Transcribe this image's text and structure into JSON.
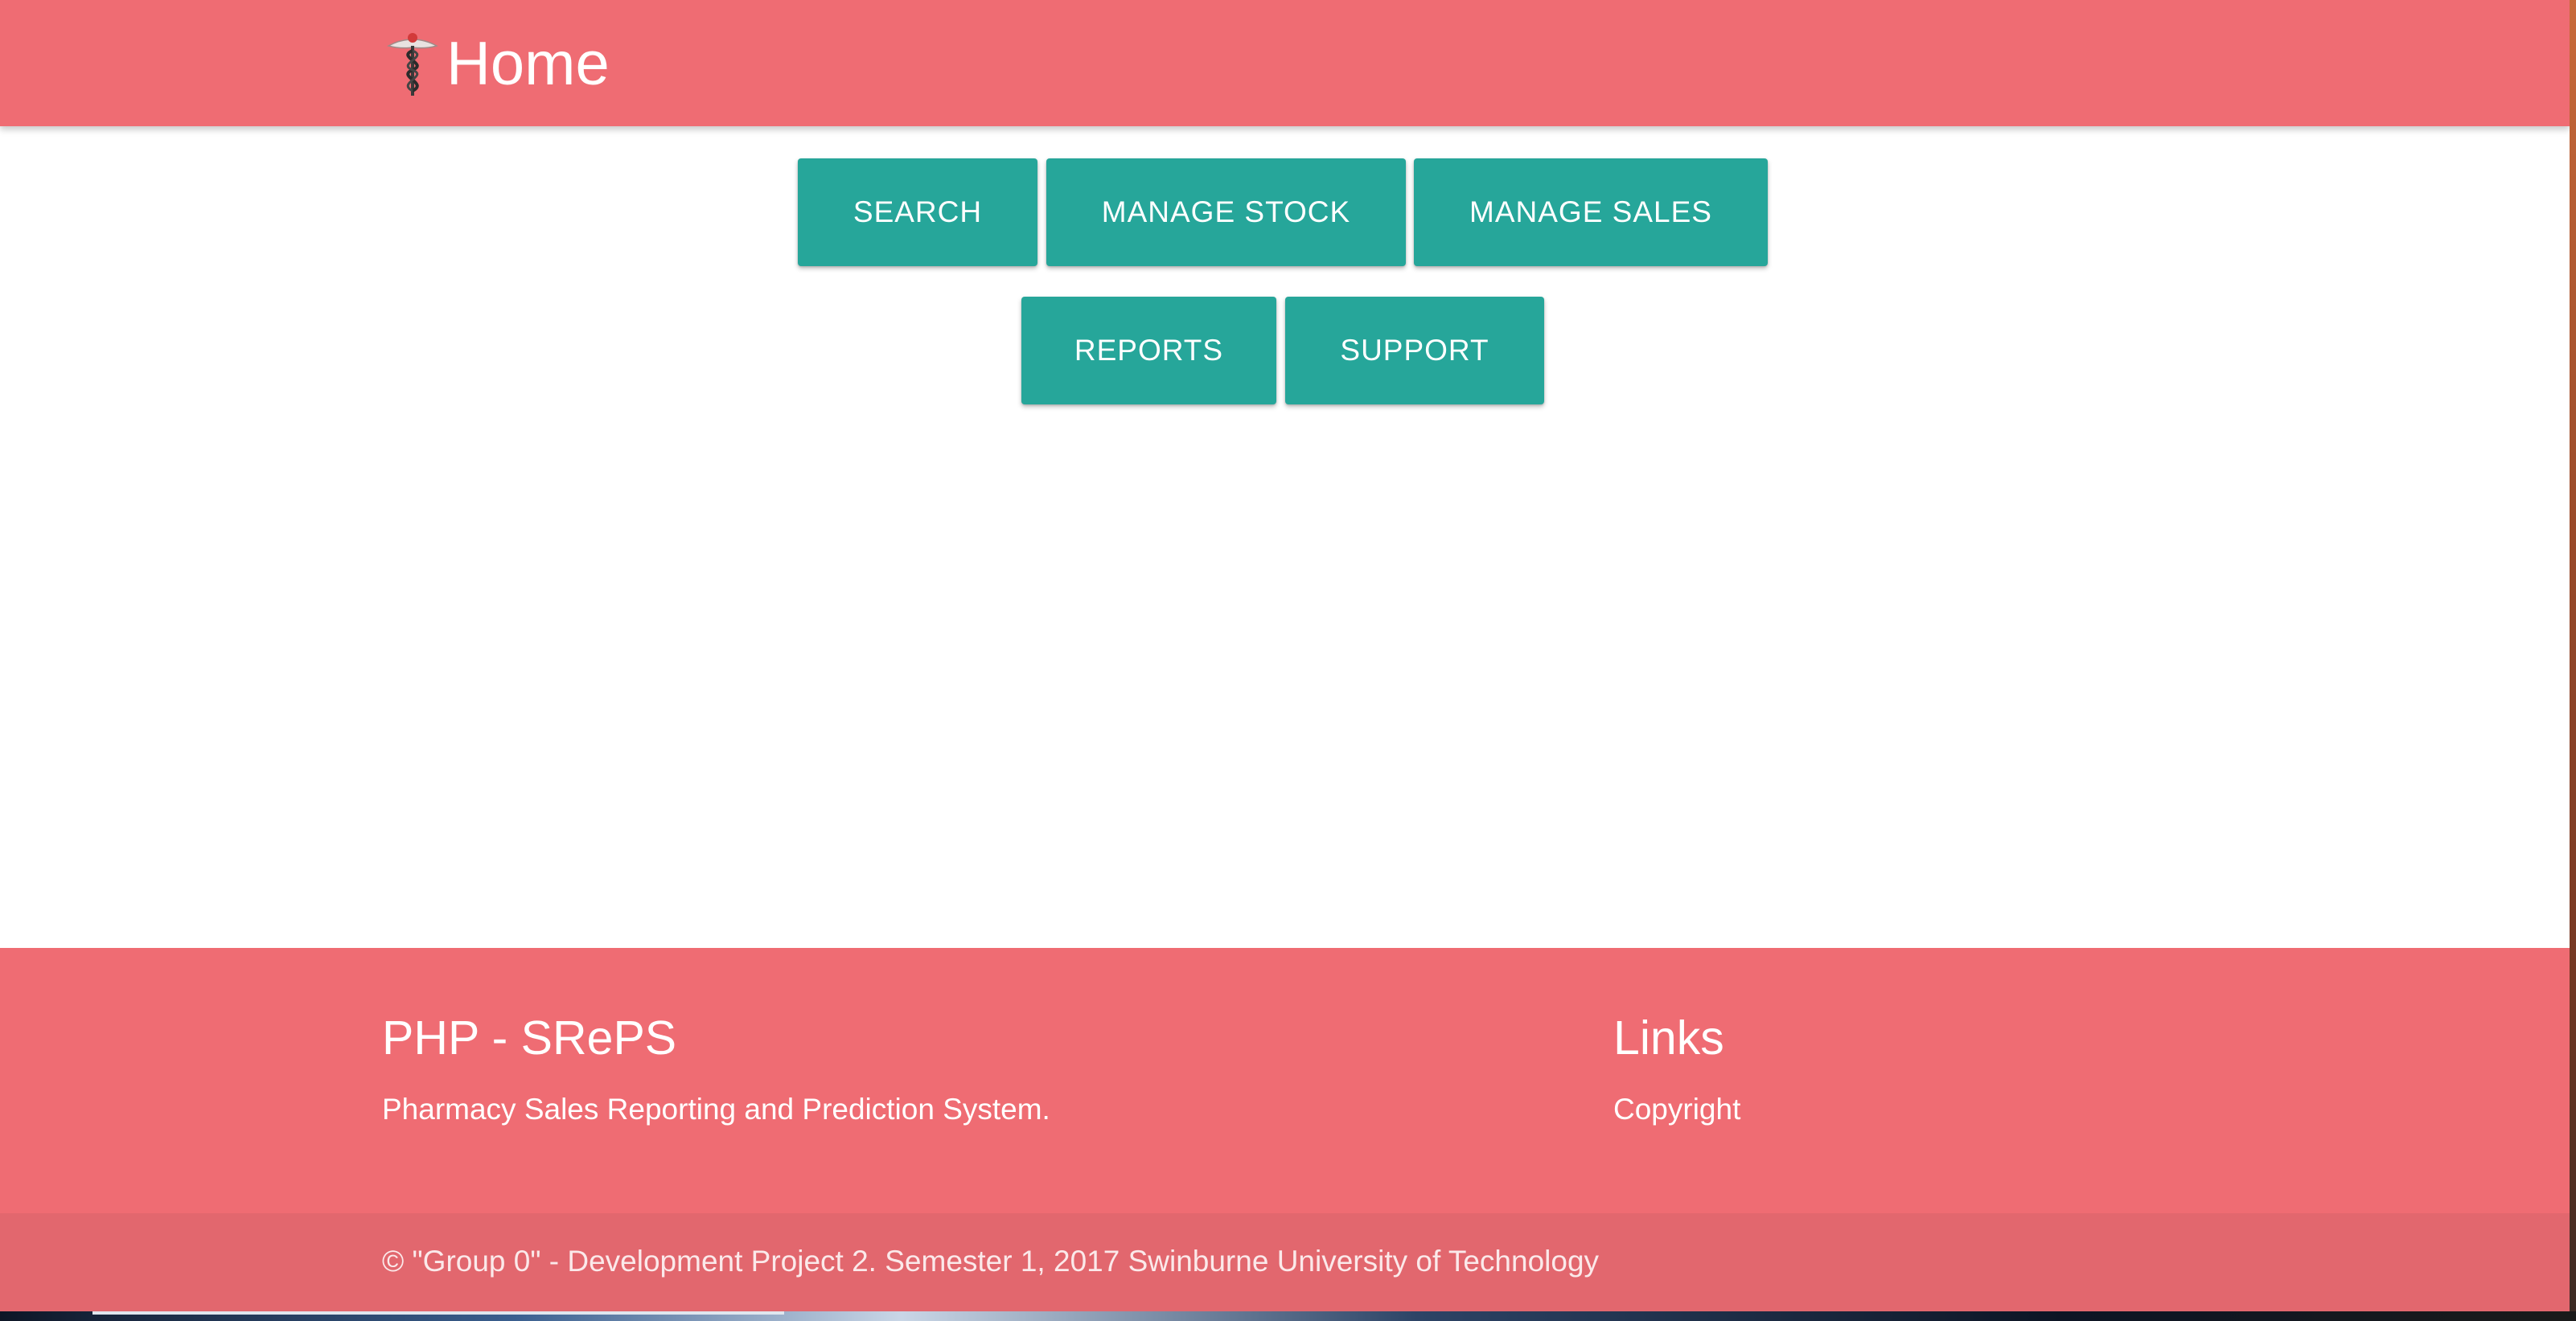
{
  "header": {
    "title": "Home",
    "logo_icon": "caduceus-icon",
    "bg_color": "#ef6c73"
  },
  "menu": {
    "buttons": [
      {
        "label": "SEARCH"
      },
      {
        "label": "MANAGE STOCK"
      },
      {
        "label": "MANAGE SALES"
      },
      {
        "label": "REPORTS"
      },
      {
        "label": "SUPPORT"
      }
    ],
    "button_color": "#26a69a"
  },
  "footer": {
    "brand_heading": "PHP - SRePS",
    "brand_text": "Pharmacy Sales Reporting and Prediction System.",
    "links_heading": "Links",
    "links": [
      {
        "label": "Copyright"
      }
    ],
    "copyright": "© \"Group 0\" - Development Project 2. Semester 1, 2017 Swinburne University of Technology"
  }
}
